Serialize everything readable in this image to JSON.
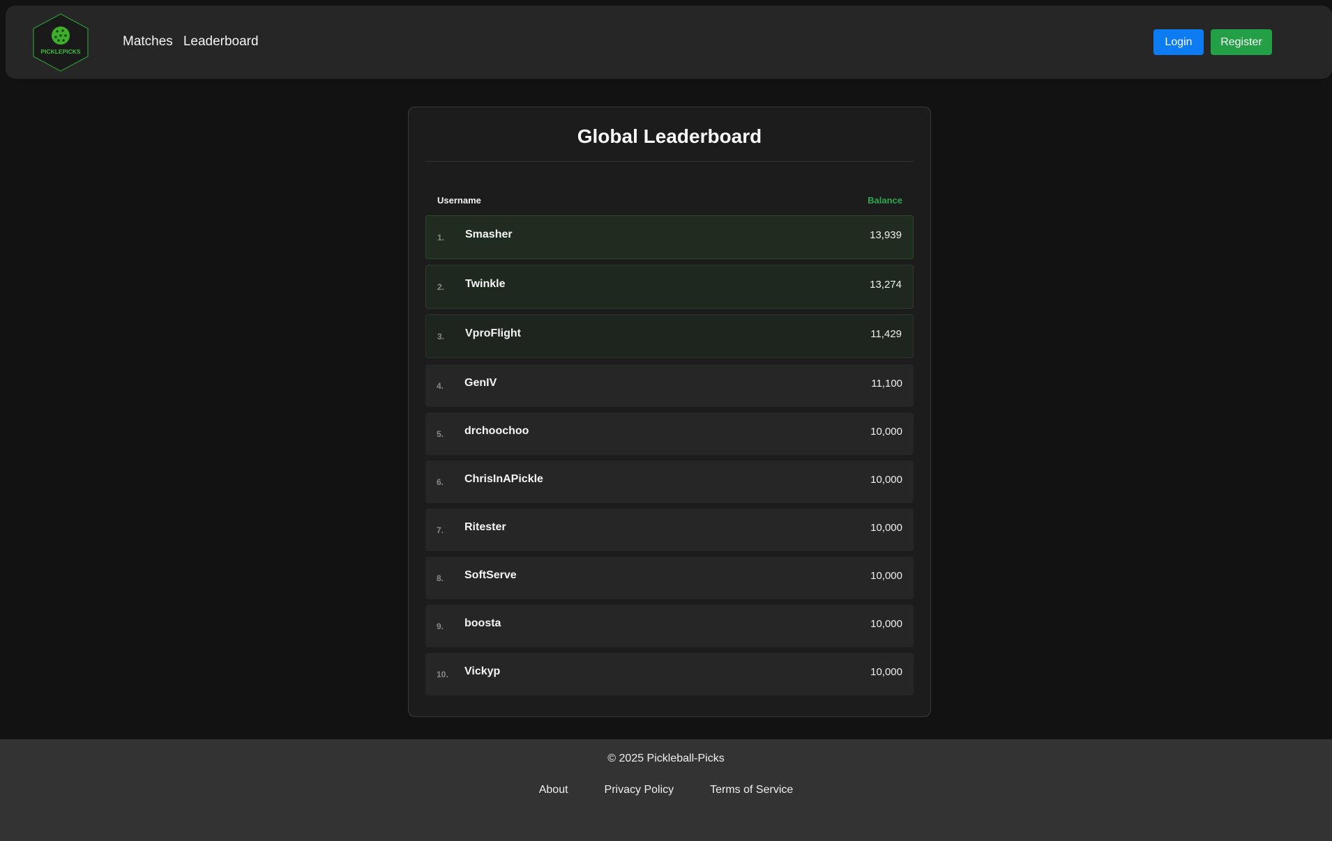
{
  "brand": {
    "logo_text": "PICKLEPICKS",
    "accent_color": "#3fbf3f"
  },
  "nav": {
    "links": [
      "Matches",
      "Leaderboard"
    ],
    "login_label": "Login",
    "register_label": "Register"
  },
  "leaderboard": {
    "title": "Global Leaderboard",
    "columns": {
      "username": "Username",
      "balance": "Balance"
    },
    "rows": [
      {
        "rank": "1.",
        "username": "Smasher",
        "balance": "13,939"
      },
      {
        "rank": "2.",
        "username": "Twinkle",
        "balance": "13,274"
      },
      {
        "rank": "3.",
        "username": "VproFlight",
        "balance": "11,429"
      },
      {
        "rank": "4.",
        "username": "GenIV",
        "balance": "11,100"
      },
      {
        "rank": "5.",
        "username": "drchoochoo",
        "balance": "10,000"
      },
      {
        "rank": "6.",
        "username": "ChrisInAPickle",
        "balance": "10,000"
      },
      {
        "rank": "7.",
        "username": "Ritester",
        "balance": "10,000"
      },
      {
        "rank": "8.",
        "username": "SoftServe",
        "balance": "10,000"
      },
      {
        "rank": "9.",
        "username": "boosta",
        "balance": "10,000"
      },
      {
        "rank": "10.",
        "username": "Vickyp",
        "balance": "10,000"
      }
    ]
  },
  "footer": {
    "copyright": "© 2025 Pickleball-Picks",
    "links": [
      "About",
      "Privacy Policy",
      "Terms of Service"
    ]
  },
  "colors": {
    "page_bg": "#121212",
    "navbar_bg": "#262626",
    "login_button": "#0d7cf2",
    "register_button": "#23a046",
    "balance_header": "#2fa84f"
  }
}
